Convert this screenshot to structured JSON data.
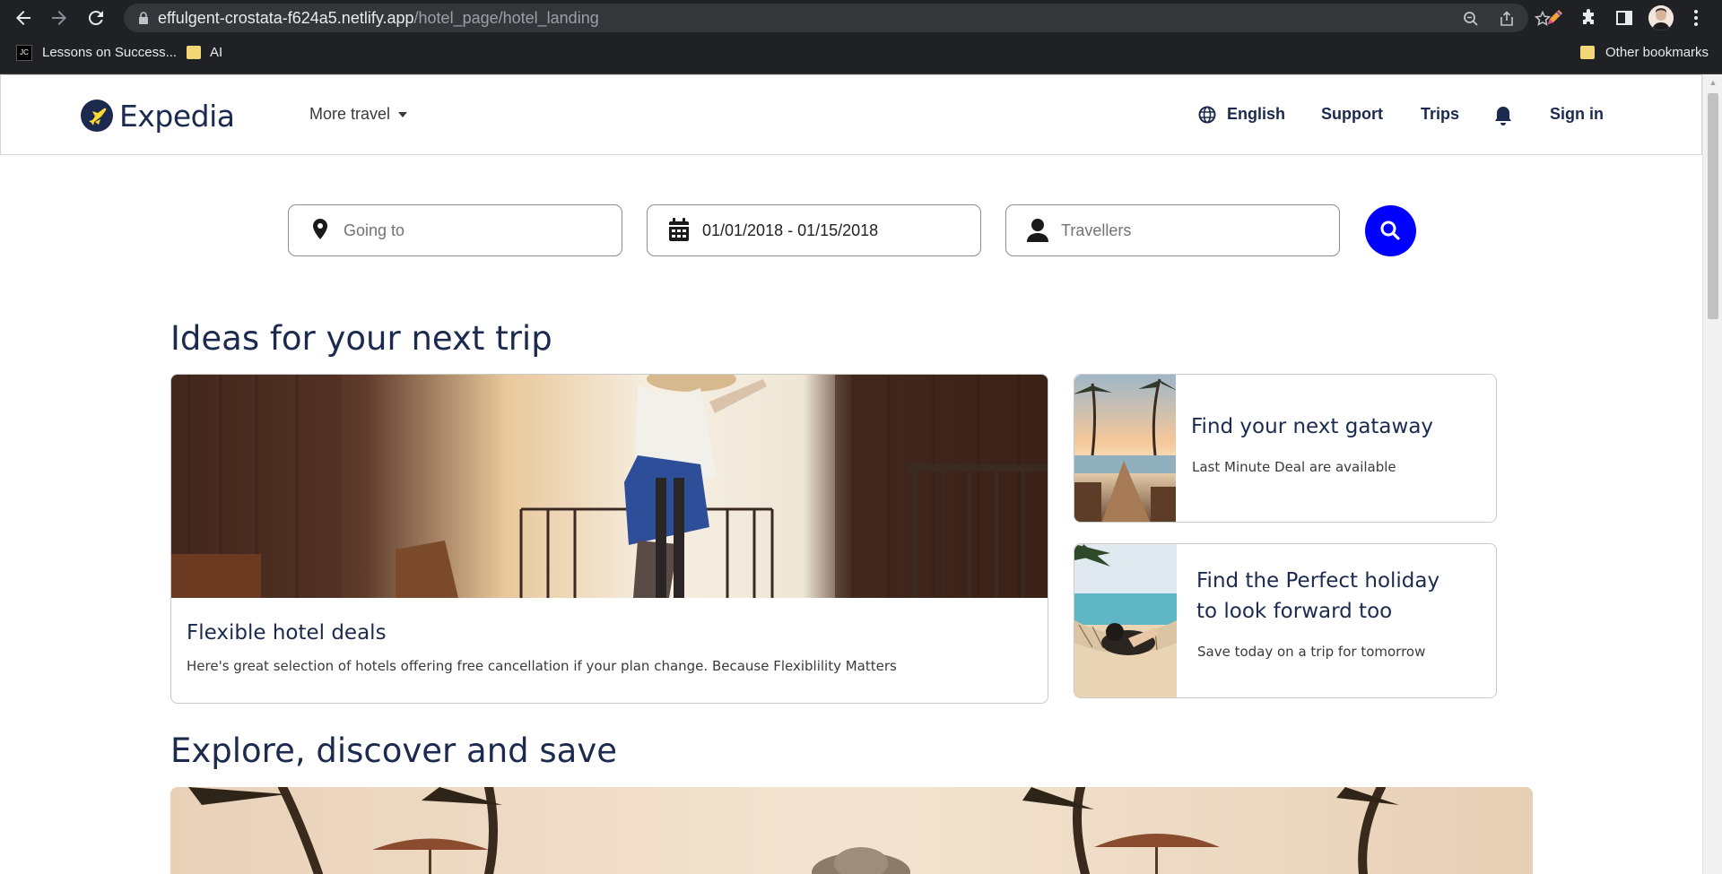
{
  "browser": {
    "url_domain": "effulgent-crostata-f624a5.netlify.app",
    "url_path": "/hotel_page/hotel_landing",
    "bookmarks": [
      {
        "label": "Lessons on Success...",
        "icon": "jc-favicon-icon"
      },
      {
        "label": "AI",
        "icon": "folder-icon"
      }
    ],
    "other_bookmarks": "Other bookmarks",
    "bookmark_badge": "JC"
  },
  "nav": {
    "logo_text": "Expedia",
    "more_travel": "More travel",
    "language": "English",
    "support": "Support",
    "trips": "Trips",
    "sign_in": "Sign in"
  },
  "search": {
    "destination_placeholder": "Going to",
    "dates": "01/01/2018 - 01/15/2018",
    "travellers_placeholder": "Travellers"
  },
  "ideas": {
    "title": "Ideas for your next trip",
    "cards": [
      {
        "title": "Flexible hotel deals",
        "description": "Here's great selection of hotels offering free cancellation if your plan change. Because Flexiblility Matters"
      },
      {
        "title": "Find your next gataway",
        "description": "Last Minute Deal are available"
      },
      {
        "title": "Find the Perfect holiday to look forward too",
        "description": "Save today on a trip for tomorrow"
      }
    ]
  },
  "explore": {
    "title": "Explore, discover and save"
  },
  "colors": {
    "brand_navy": "#1b2a4e",
    "search_button": "#0000ff",
    "logo_accent": "#fddb32"
  }
}
